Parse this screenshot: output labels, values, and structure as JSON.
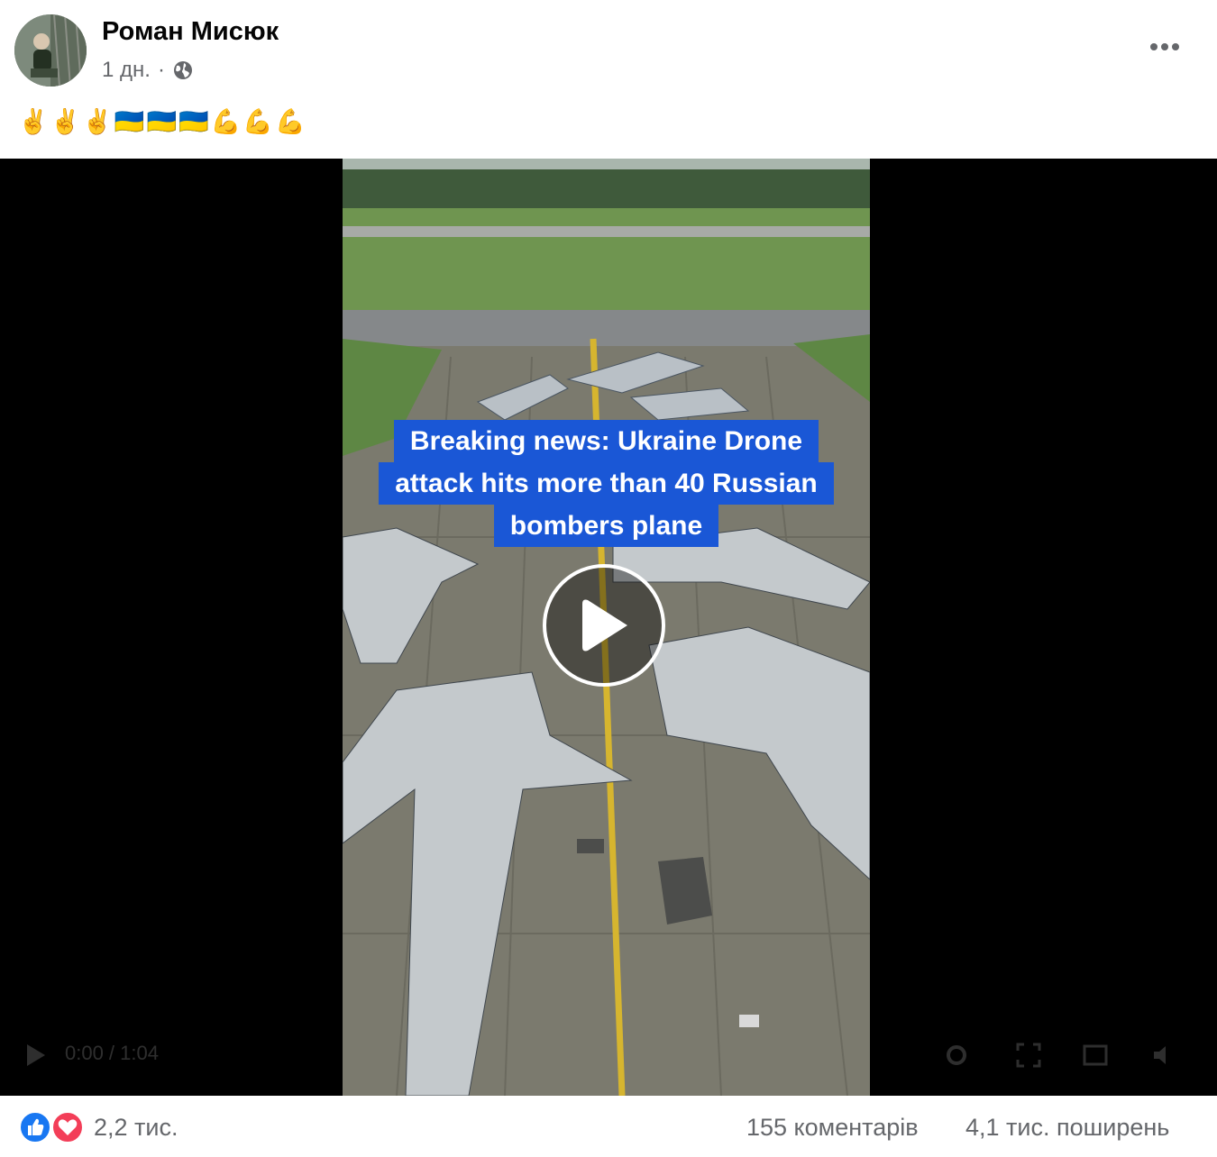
{
  "post": {
    "author": "Роман Мисюк",
    "time": "1 дн.",
    "separator": "·",
    "audience_icon": "globe-icon",
    "more_icon": "more-dots-icon",
    "text": "✌️✌️✌️🇺🇦🇺🇦🇺🇦💪💪💪"
  },
  "video": {
    "caption_lines": [
      "Breaking news: Ukraine Drone",
      "attack hits more than 40 Russian",
      "bombers plane"
    ],
    "play_icon": "play-icon",
    "time_display": "0:00 / 1:04",
    "caption_color": "#1a57d6"
  },
  "footer": {
    "reactions": [
      "like-icon",
      "love-icon"
    ],
    "reaction_count": "2,2 тис.",
    "comments": "155 коментарів",
    "shares": "4,1 тис. поширень"
  },
  "colors": {
    "like": "#1877f2",
    "love": "#f33e58",
    "secondary_text": "#65676b"
  }
}
